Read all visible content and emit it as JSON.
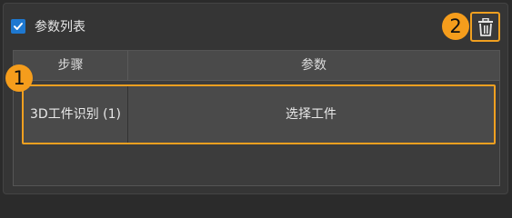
{
  "header": {
    "title": "参数列表",
    "checked": true
  },
  "callouts": {
    "first": "1",
    "second": "2"
  },
  "table": {
    "columns": [
      "步骤",
      "参数"
    ],
    "rows": [
      {
        "step": "3D工件识别 (1)",
        "param": "选择工件"
      }
    ]
  },
  "colors": {
    "accent": "#f0a020",
    "checkbox": "#1e78d0",
    "callout": "#f59d1c"
  },
  "icons": {
    "checkbox": "check-icon",
    "delete": "trash-icon"
  }
}
